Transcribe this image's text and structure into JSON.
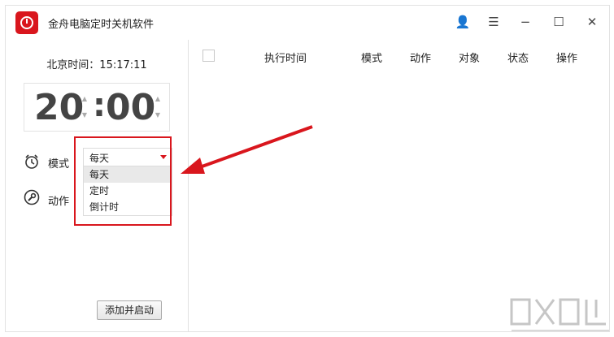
{
  "app": {
    "title": "金舟电脑定时关机软件"
  },
  "titlebar": {
    "user_icon": "👤",
    "menu_icon": "☰",
    "minimize_icon": "−",
    "maximize_icon": "☐",
    "close_icon": "✕"
  },
  "clock": {
    "beijing_time": "北京时间：15:17:11"
  },
  "timer": {
    "hours": "20",
    "colon": ":",
    "minutes": "00"
  },
  "mode": {
    "label": "模式",
    "selected": "每天",
    "options": [
      "每天",
      "定时",
      "倒计时"
    ]
  },
  "action": {
    "label": "动作"
  },
  "buttons": {
    "start": "添加并启动"
  },
  "table": {
    "headers": [
      "执行时间",
      "模式",
      "动作",
      "对象",
      "状态",
      "操作"
    ]
  },
  "colors": {
    "accent": "#d9161d"
  }
}
